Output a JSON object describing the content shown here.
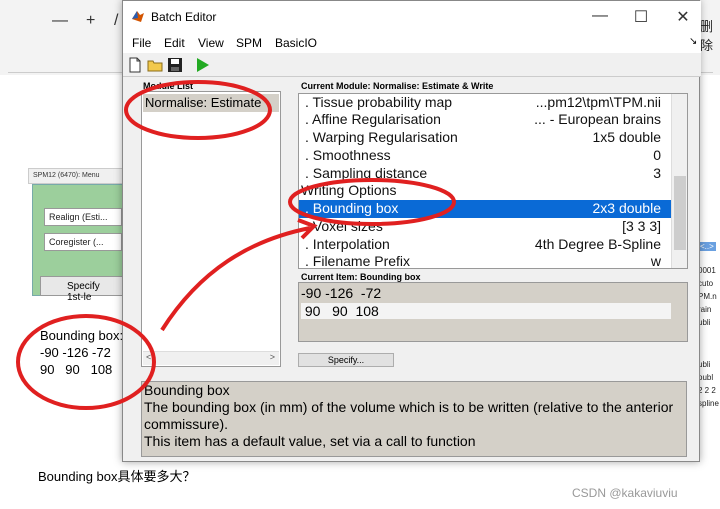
{
  "background": {
    "window_controls": [
      "—",
      "+",
      "/"
    ],
    "top_right_text": "删除",
    "spm_menu_title": "SPM12 (6470): Menu",
    "spm_dropdowns": [
      "Realign (Esti...",
      "Coregister (..."
    ],
    "spm_button": "Specify 1st-le",
    "note_title": "Bounding box:",
    "note_row1": "-90 -126 -72",
    "note_row2": "90   90   108",
    "right_peek": [
      "<..>",
      "0001",
      "cuto",
      "PM.n",
      "rain",
      "ubli",
      "ubli",
      "oubl",
      "2 2 2",
      "spline"
    ],
    "caption": "Bounding box具体要多大？",
    "watermark": "CSDN @kakaviuviu"
  },
  "window": {
    "title": "Batch Editor",
    "controls": {
      "minimize": "—",
      "maximize": "☐",
      "close": "✕"
    },
    "menu": [
      "File",
      "Edit",
      "View",
      "SPM",
      "BasicIO"
    ],
    "menu_right_glyph": "↘",
    "module_list_label": "Module List",
    "modules": [
      "Normalise: Estimate"
    ],
    "current_module_label": "Current Module: Normalise: Estimate & Write",
    "tree_rows": [
      {
        "label": ". Tissue probability map",
        "value": "...pm12\\tpm\\TPM.nii"
      },
      {
        "label": ". Affine Regularisation",
        "value": "... - European brains"
      },
      {
        "label": ". Warping Regularisation",
        "value": "1x5 double"
      },
      {
        "label": ". Smoothness",
        "value": "0"
      },
      {
        "label": ". Sampling distance",
        "value": "3"
      },
      {
        "label": "Writing Options",
        "value": ""
      },
      {
        "label": ". Bounding box",
        "value": "2x3 double"
      },
      {
        "label": ". Voxel sizes",
        "value": "[3 3 3]"
      },
      {
        "label": ". Interpolation",
        "value": "4th Degree B-Spline"
      },
      {
        "label": ". Filename Prefix",
        "value": "w"
      }
    ],
    "selected_row_index": 6,
    "current_item_label": "Current Item: Bounding box",
    "current_item_lines": [
      "-90 -126  -72",
      " 90   90  108"
    ],
    "specify_button": "Specify...",
    "help_title": "Bounding box",
    "help_text": "The bounding box (in mm) of the volume which is to be written (relative to the anterior commissure).",
    "help_text2": "This item has a default value, set via a call to function"
  },
  "colors": {
    "selection": "#0a6ad6",
    "annotation": "#e02020",
    "run_icon": "#22aa22"
  }
}
